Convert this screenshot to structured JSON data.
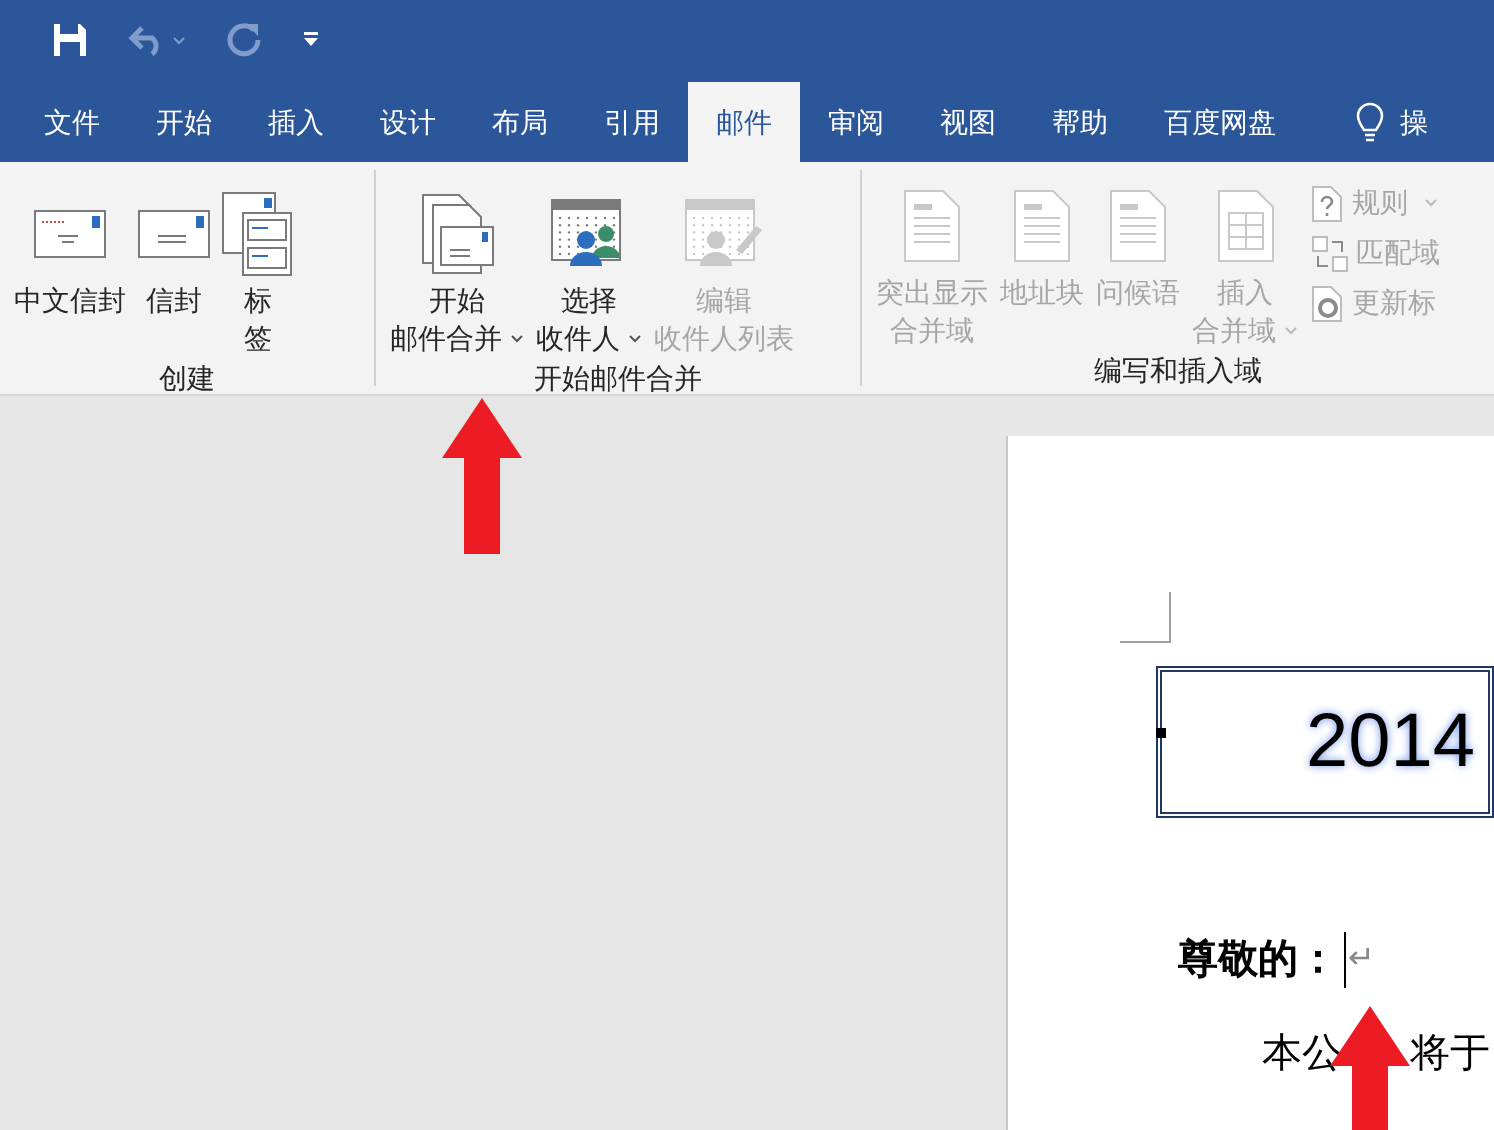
{
  "quick_access": [
    {
      "kind": "save",
      "disabled": false
    },
    {
      "kind": "undo",
      "disabled": true,
      "dropdown": true
    },
    {
      "kind": "redo",
      "disabled": true
    },
    {
      "kind": "customize",
      "disabled": false
    }
  ],
  "tabs": [
    {
      "label": "文件",
      "selected": false
    },
    {
      "label": "开始",
      "selected": false
    },
    {
      "label": "插入",
      "selected": false
    },
    {
      "label": "设计",
      "selected": false
    },
    {
      "label": "布局",
      "selected": false
    },
    {
      "label": "引用",
      "selected": false
    },
    {
      "label": "邮件",
      "selected": true
    },
    {
      "label": "审阅",
      "selected": false
    },
    {
      "label": "视图",
      "selected": false
    },
    {
      "label": "帮助",
      "selected": false
    },
    {
      "label": "百度网盘",
      "selected": false
    }
  ],
  "tell_me": {
    "label": "操"
  },
  "groups": [
    {
      "label": "创建",
      "buttons": [
        {
          "kind": "cn-envelope",
          "lines": [
            "中文信封"
          ],
          "disabled": false,
          "dropdown": false
        },
        {
          "kind": "envelope",
          "lines": [
            "信封"
          ],
          "disabled": false,
          "dropdown": false
        },
        {
          "kind": "labels",
          "lines": [
            "标",
            "签"
          ],
          "disabled": false,
          "dropdown": false
        }
      ]
    },
    {
      "label": "开始邮件合并",
      "buttons": [
        {
          "kind": "start-merge",
          "lines": [
            "开始",
            "邮件合并"
          ],
          "disabled": false,
          "dropdown": true
        },
        {
          "kind": "recipients",
          "lines": [
            "选择",
            "收件人"
          ],
          "disabled": false,
          "dropdown": true
        },
        {
          "kind": "edit-list",
          "lines": [
            "编辑",
            "收件人列表"
          ],
          "disabled": true,
          "dropdown": false
        }
      ]
    },
    {
      "label": "编写和插入域",
      "buttons": [
        {
          "kind": "doc",
          "lines": [
            "突出显示",
            "合并域"
          ],
          "disabled": true,
          "dropdown": false
        },
        {
          "kind": "doc",
          "lines": [
            "地址块"
          ],
          "disabled": true,
          "dropdown": false
        },
        {
          "kind": "doc",
          "lines": [
            "问候语"
          ],
          "disabled": true,
          "dropdown": false
        },
        {
          "kind": "grid-doc",
          "lines": [
            "插入",
            "合并域"
          ],
          "disabled": true,
          "dropdown": true
        }
      ],
      "small_buttons": [
        {
          "kind": "rules",
          "label": "规则",
          "disabled": true,
          "dropdown": true
        },
        {
          "kind": "match",
          "label": "匹配域",
          "disabled": true,
          "dropdown": false
        },
        {
          "kind": "update",
          "label": "更新标",
          "disabled": true,
          "dropdown": false
        }
      ]
    }
  ],
  "document": {
    "title": "2014",
    "salutation": "尊敬的：",
    "paragraph_mark": "↵",
    "body_parts": [
      "本公",
      "将于"
    ]
  }
}
